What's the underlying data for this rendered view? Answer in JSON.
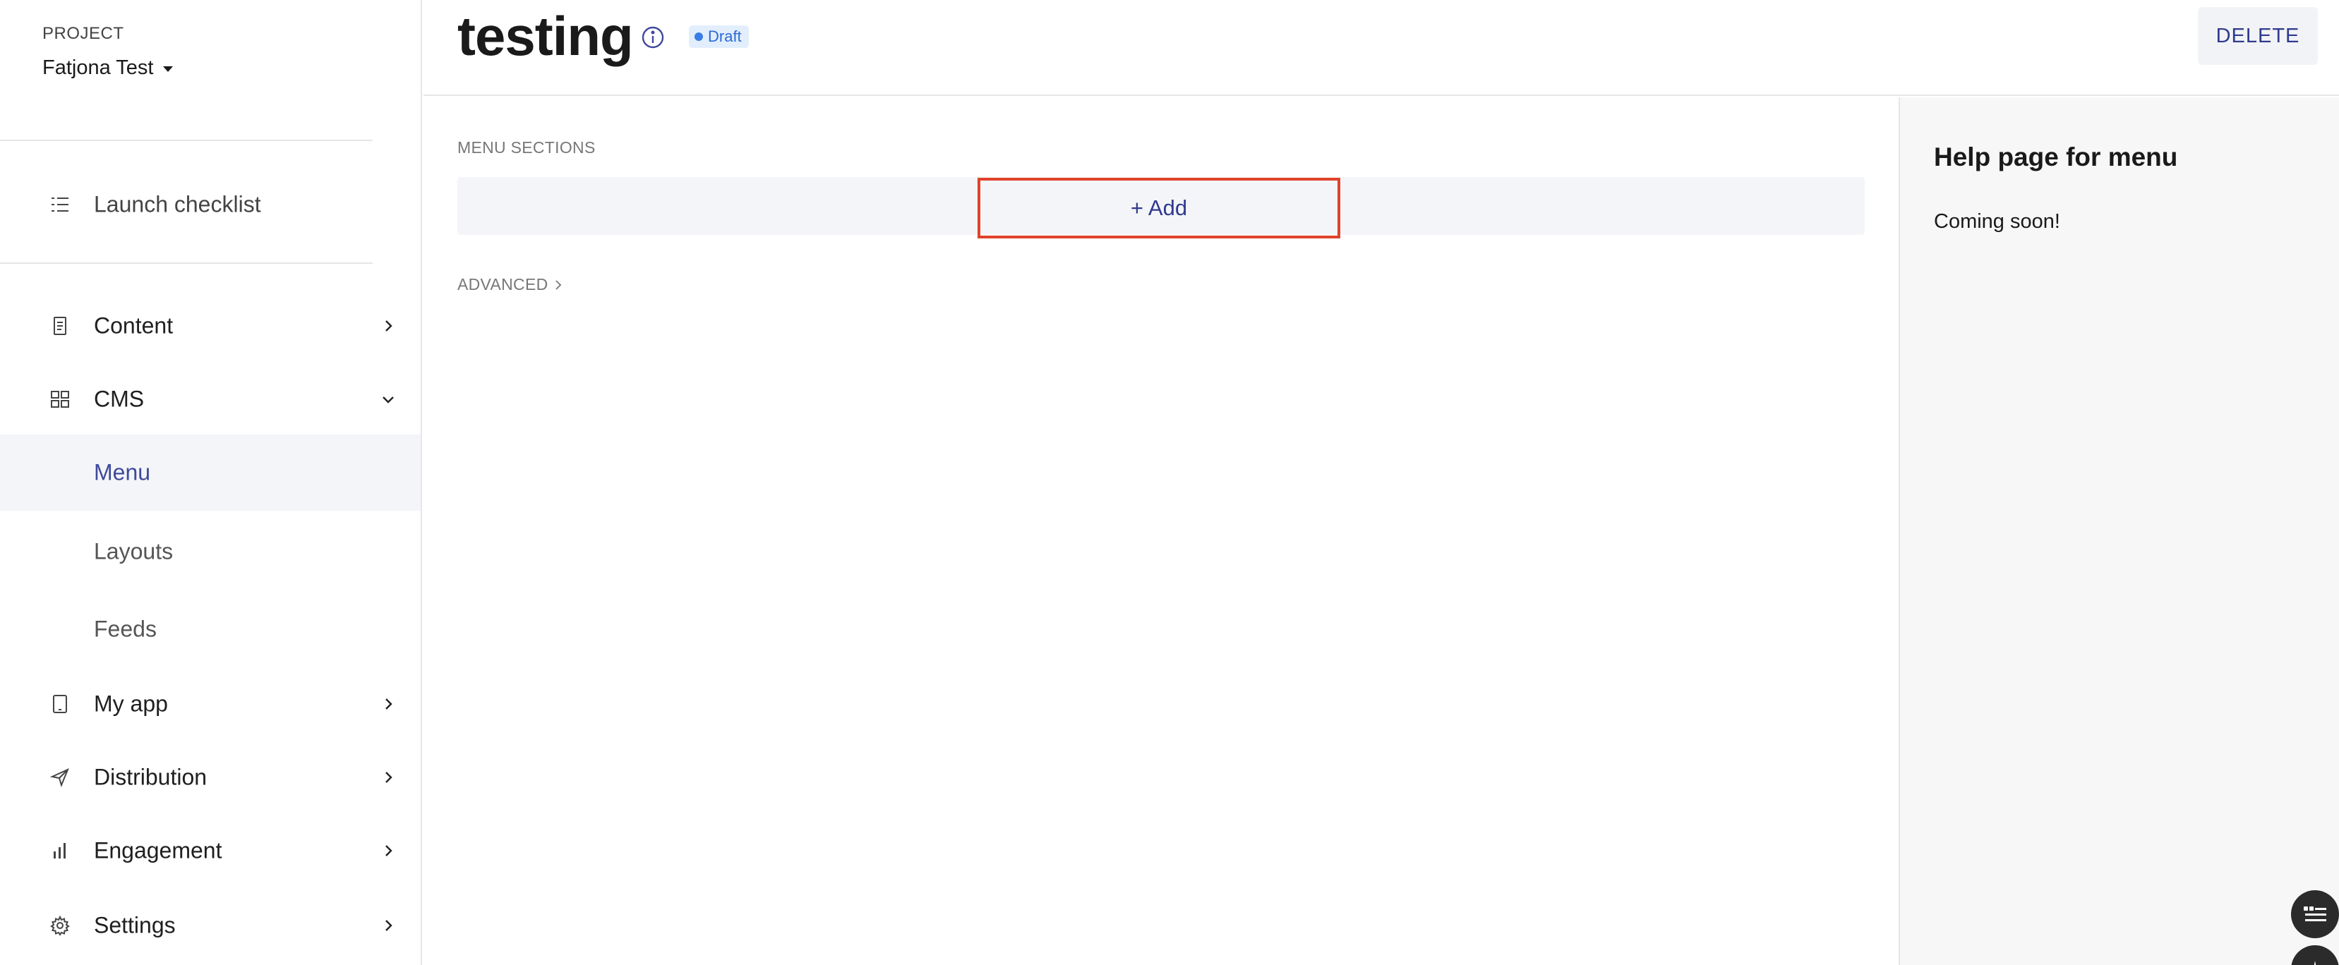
{
  "sidebar": {
    "project_label": "PROJECT",
    "project_name": "Fatjona Test",
    "launch_checklist": "Launch checklist",
    "items": {
      "content": "Content",
      "cms": "CMS",
      "my_app": "My app",
      "distribution": "Distribution",
      "engagement": "Engagement",
      "settings": "Settings"
    },
    "cms_children": {
      "menu": "Menu",
      "layouts": "Layouts",
      "feeds": "Feeds"
    },
    "active_item": "Menu"
  },
  "header": {
    "title": "testing",
    "status_badge": "Draft",
    "delete_label": "DELETE"
  },
  "main": {
    "section_label": "MENU SECTIONS",
    "add_label": "+ Add",
    "advanced_label": "ADVANCED"
  },
  "help": {
    "title": "Help page for menu",
    "body": "Coming soon!"
  },
  "colors": {
    "accent": "#2f3a8f",
    "active_text": "#3f4a9c",
    "highlight_border": "#e0432b",
    "draft_bg": "#e3eefd",
    "draft_text": "#2b6bd6"
  },
  "icons": {
    "launch_checklist": "checklist-icon",
    "content": "document-icon",
    "cms": "grid-icon",
    "my_app": "tablet-icon",
    "distribution": "send-icon",
    "engagement": "bar-chart-icon",
    "settings": "gear-icon"
  }
}
